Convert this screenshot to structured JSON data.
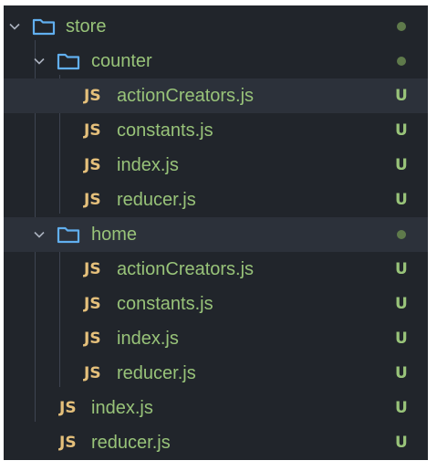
{
  "tree": {
    "store": {
      "name": "store",
      "status": "dot"
    },
    "counter": {
      "name": "counter",
      "files": [
        {
          "icon": "JS",
          "name": "actionCreators.js",
          "status": "U"
        },
        {
          "icon": "JS",
          "name": "constants.js",
          "status": "U"
        },
        {
          "icon": "JS",
          "name": "index.js",
          "status": "U"
        },
        {
          "icon": "JS",
          "name": "reducer.js",
          "status": "U"
        }
      ]
    },
    "home": {
      "name": "home",
      "files": [
        {
          "icon": "JS",
          "name": "actionCreators.js",
          "status": "U"
        },
        {
          "icon": "JS",
          "name": "constants.js",
          "status": "U"
        },
        {
          "icon": "JS",
          "name": "index.js",
          "status": "U"
        },
        {
          "icon": "JS",
          "name": "reducer.js",
          "status": "U"
        }
      ]
    },
    "root_files": [
      {
        "icon": "JS",
        "name": "index.js",
        "status": "U"
      },
      {
        "icon": "JS",
        "name": "reducer.js",
        "status": "U"
      }
    ]
  },
  "colors": {
    "background": "#21252b",
    "folder_icon": "#61afef",
    "js_icon": "#e5c07b",
    "untracked": "#98c379",
    "modified_dot": "#5f7a4b"
  }
}
